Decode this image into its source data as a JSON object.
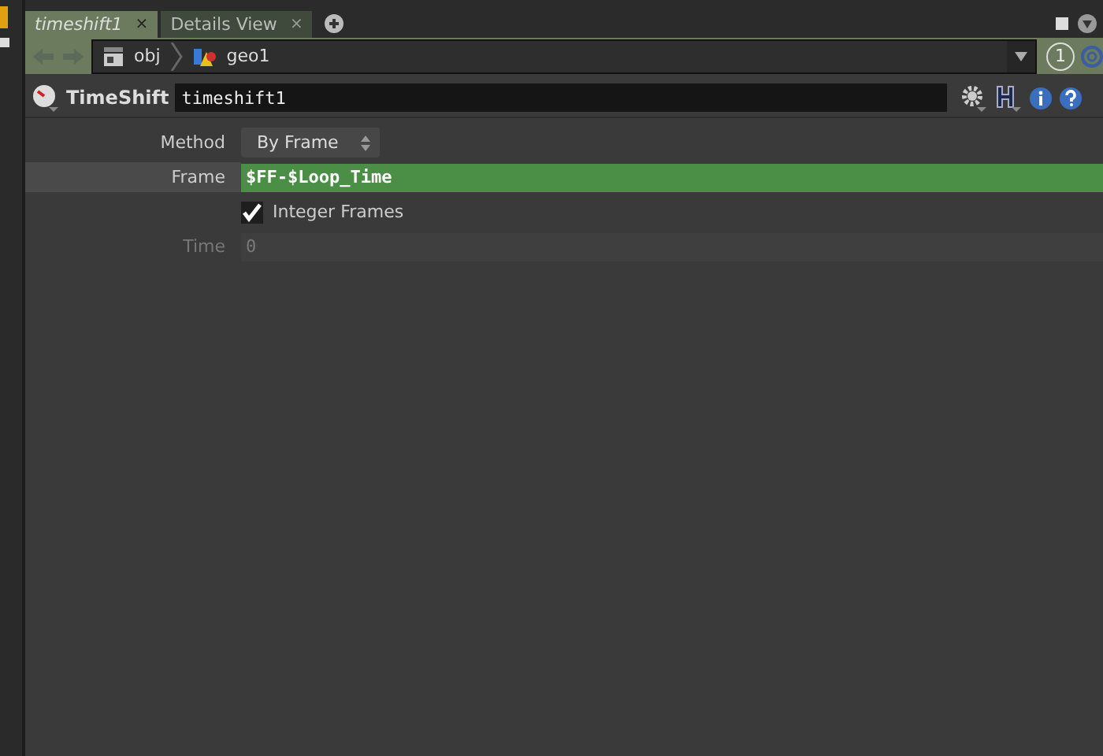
{
  "tabs": [
    {
      "label": "timeshift1",
      "selected": true,
      "close": "×"
    },
    {
      "label": "Details View",
      "selected": false,
      "close": "×"
    }
  ],
  "path": {
    "items": [
      {
        "label": "obj",
        "kind": "network"
      },
      {
        "label": "geo1",
        "kind": "geometry"
      }
    ],
    "pane_number": "1"
  },
  "node": {
    "type": "TimeShift",
    "name": "timeshift1"
  },
  "parameters": [
    {
      "kind": "menu",
      "label": "Method",
      "value": "By Frame",
      "highlighted": false,
      "disabled": false
    },
    {
      "kind": "expression",
      "label": "Frame",
      "value": "$FF-$Loop_Time",
      "highlighted": true,
      "disabled": false
    },
    {
      "kind": "toggle",
      "label": "Integer Frames",
      "checked": true,
      "disabled": false
    },
    {
      "kind": "number",
      "label": "Time",
      "value": "0",
      "highlighted": false,
      "disabled": true
    }
  ]
}
